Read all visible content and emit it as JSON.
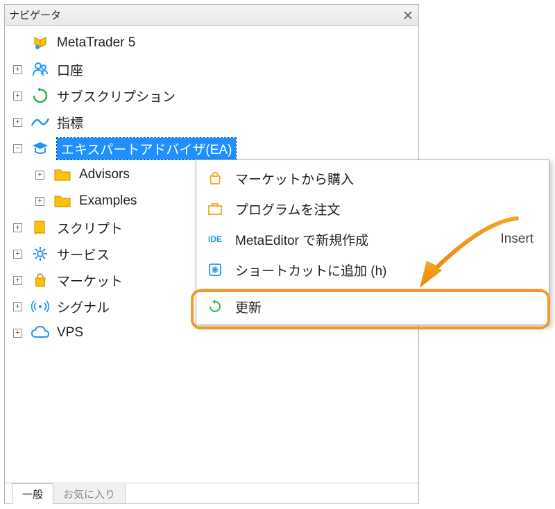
{
  "panel": {
    "title": "ナビゲータ"
  },
  "tree": {
    "root": "MetaTrader 5",
    "account": "口座",
    "subscription": "サブスクリプション",
    "indicators": "指標",
    "expert_advisors": "エキスパートアドバイザ(EA)",
    "advisors": "Advisors",
    "examples": "Examples",
    "scripts": "スクリプト",
    "services": "サービス",
    "market": "マーケット",
    "signals": "シグナル",
    "vps": "VPS"
  },
  "tabs": {
    "active": "一般",
    "inactive": "お気に入り"
  },
  "menu": {
    "buy_from_market": "マーケットから購入",
    "order_program": "プログラムを注文",
    "new_in_metaeditor": "MetaEditor で新規作成",
    "new_in_metaeditor_shortcut": "Insert",
    "add_shortcut": "ショートカットに追加 (h)",
    "refresh": "更新"
  }
}
